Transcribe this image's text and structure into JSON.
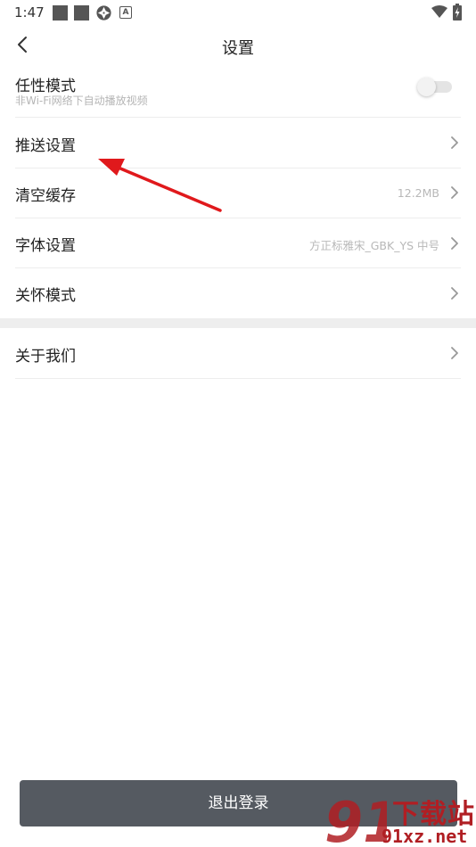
{
  "status_bar": {
    "time": "1:47",
    "icons": [
      "square-icon",
      "square-icon",
      "aperture-icon",
      "a-badge-icon",
      "wifi-icon",
      "battery-charging-icon"
    ]
  },
  "header": {
    "title": "设置",
    "back_icon": "chevron-left-icon"
  },
  "settings": [
    {
      "id": "willful",
      "label": "任性模式",
      "sublabel": "非Wi-Fi网络下自动播放视频",
      "type": "toggle",
      "on": false
    },
    {
      "id": "push",
      "label": "推送设置",
      "type": "link"
    },
    {
      "id": "cache",
      "label": "清空缓存",
      "value": "12.2MB",
      "type": "link"
    },
    {
      "id": "font",
      "label": "字体设置",
      "value": "方正标雅宋_GBK_YS 中号",
      "type": "link"
    },
    {
      "id": "care",
      "label": "关怀模式",
      "type": "link"
    }
  ],
  "settings2": [
    {
      "id": "about",
      "label": "关于我们",
      "type": "link"
    }
  ],
  "logout_label": "退出登录",
  "watermark": {
    "text_top": "下载站",
    "text_bottom": "91xz.net",
    "logo_text": "91"
  },
  "colors": {
    "annotation_arrow": "#e0191c",
    "logout_bg": "#555a61",
    "watermark": "#b01e23"
  }
}
